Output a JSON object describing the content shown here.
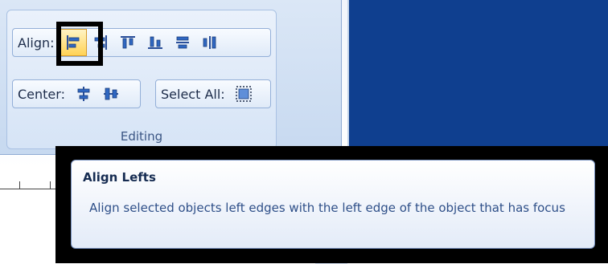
{
  "ribbon": {
    "align_label": "Align:",
    "center_label": "Center:",
    "select_all_label": "Select All:",
    "group_label": "Editing",
    "align_buttons": [
      {
        "icon": "align-left-icon",
        "active": true
      },
      {
        "icon": "align-right-icon",
        "active": false
      },
      {
        "icon": "align-top-icon",
        "active": false
      },
      {
        "icon": "align-bottom-icon",
        "active": false
      },
      {
        "icon": "align-middle-icon",
        "active": false
      },
      {
        "icon": "align-center-icon",
        "active": false
      }
    ],
    "center_buttons": [
      {
        "icon": "center-horizontally-icon"
      },
      {
        "icon": "center-vertically-icon"
      }
    ],
    "select_all_icon": "select-all-icon"
  },
  "tooltip": {
    "title": "Align Lefts",
    "body": "Align selected objects left edges with the left edge of the object that has focus"
  },
  "colors": {
    "right_panel": "#0f3f8f",
    "active_button": "#ffd255",
    "icon_blue": "#2a4f9a"
  }
}
